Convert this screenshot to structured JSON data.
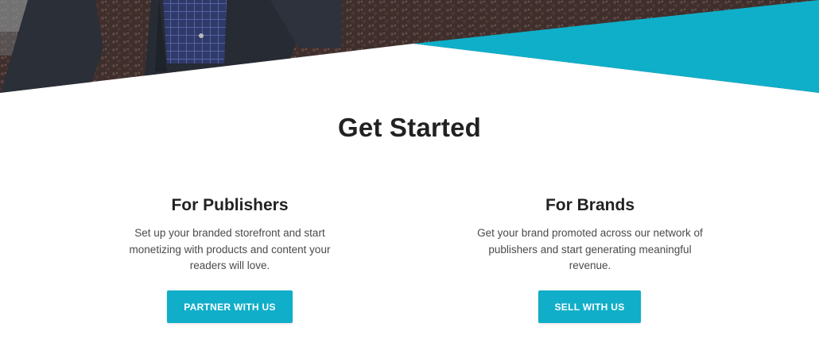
{
  "hero": {
    "accent_color": "#0fafc9"
  },
  "section": {
    "title": "Get Started"
  },
  "publishers": {
    "heading": "For Publishers",
    "description": "Set up your branded storefront and start monetizing with products and content your readers will love.",
    "button_label": "PARTNER WITH US"
  },
  "brands": {
    "heading": "For Brands",
    "description": "Get your brand promoted across our network of publishers and start generating meaningful revenue.",
    "button_label": "SELL WITH US"
  },
  "colors": {
    "button": "#10aec9",
    "text": "#222222"
  }
}
